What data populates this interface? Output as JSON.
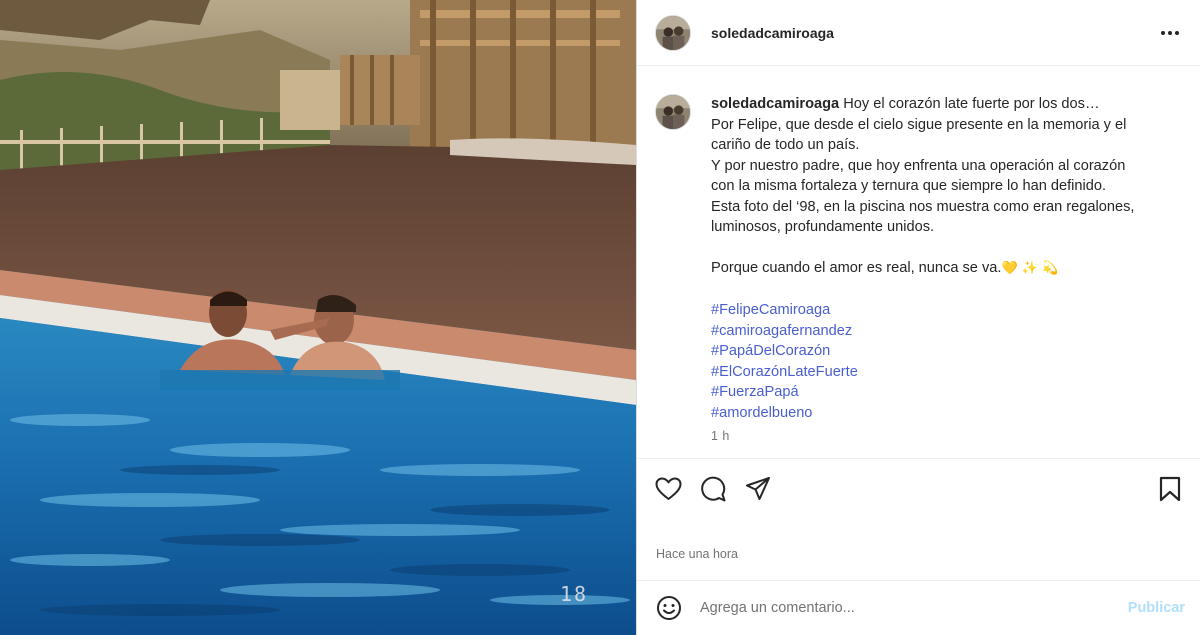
{
  "post": {
    "username": "soledadcamiroaga",
    "photo_stamp": "18",
    "caption": {
      "username": "soledadcamiroaga",
      "lines": [
        "Hoy el corazón late fuerte por los dos…",
        "Por Felipe, que desde el cielo sigue presente en la memoria y el",
        "cariño de todo un país.",
        "Y por nuestro padre, que hoy enfrenta una operación al corazón",
        "con la misma fortaleza y ternura que siempre lo han definido.",
        "Esta foto del ‘98, en la piscina nos muestra como eran regalones,",
        "luminosos, profundamente unidos."
      ],
      "closing": "Porque cuando el amor es real, nunca se va.",
      "closing_emojis": [
        "💛",
        "✨",
        "💫"
      ],
      "hashtags": [
        "#FelipeCamiroaga",
        "#camiroagafernandez",
        "#PapáDelCorazón",
        "#ElCorazónLateFuerte",
        "#FuerzaPapá",
        "#amordelbueno"
      ],
      "relative_time": "1 h"
    },
    "posted_when": "Hace una hora"
  },
  "icons": {
    "more": "more-horizontal-icon",
    "like": "heart-icon",
    "comment": "comment-icon",
    "share": "send-icon",
    "save": "bookmark-icon",
    "emoji": "smiley-icon"
  },
  "comment_box": {
    "placeholder": "Agrega un comentario...",
    "value": "",
    "submit_label": "Publicar"
  },
  "colors": {
    "hashtag": "#4a5ecf",
    "publish_disabled": "#b2dffc",
    "secondary_text": "#737373",
    "divider": "#efefef"
  }
}
